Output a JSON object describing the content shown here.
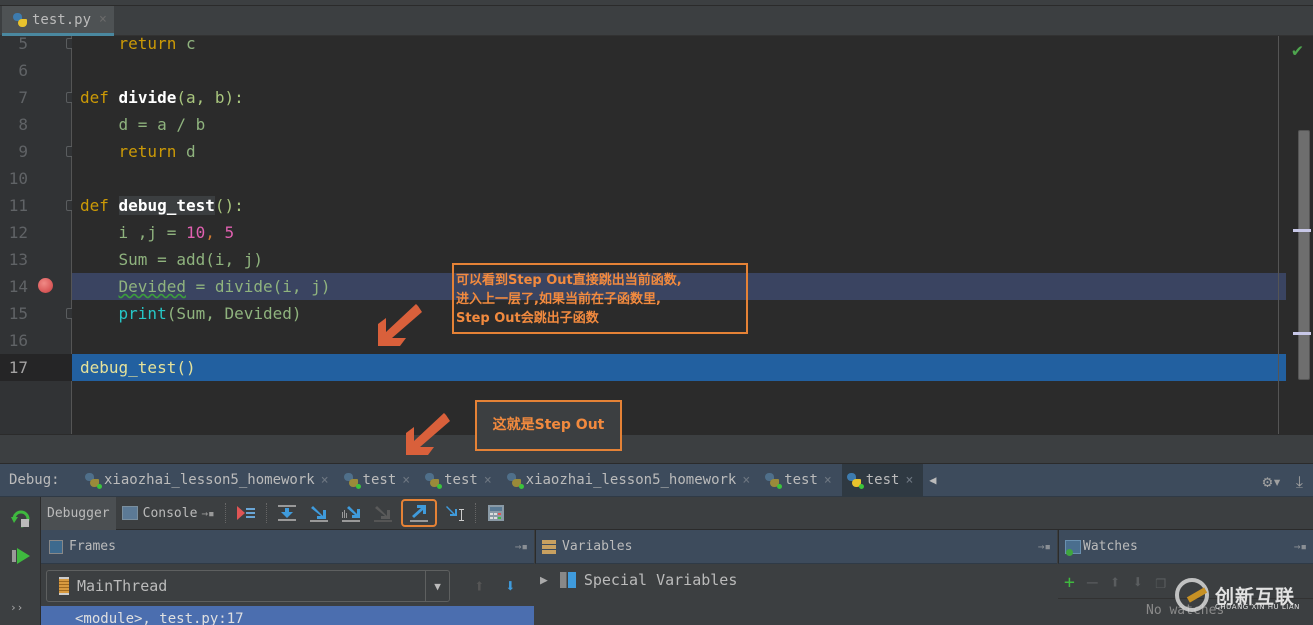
{
  "editor": {
    "file_tab": {
      "label": "test.py",
      "close": "×"
    },
    "lines": [
      {
        "num": "5"
      },
      {
        "num": "6"
      },
      {
        "num": "7"
      },
      {
        "num": "8"
      },
      {
        "num": "9"
      },
      {
        "num": "10"
      },
      {
        "num": "11"
      },
      {
        "num": "12"
      },
      {
        "num": "13"
      },
      {
        "num": "14"
      },
      {
        "num": "15"
      },
      {
        "num": "16"
      },
      {
        "num": "17"
      }
    ],
    "code": {
      "l5_kw": "return",
      "l5_v": " c",
      "l7_kw": "def",
      "l7_fn": "divide",
      "l7_args": "(a, b):",
      "l8_text": "d = a / b",
      "l9_kw": "return",
      "l9_v": " d",
      "l11_kw": "def",
      "l11_fn": "debug_test",
      "l11_args": "():",
      "l12_a": "i ,j = ",
      "l12_n1": "10",
      "l12_c": ", ",
      "l12_n2": "5",
      "l13_text": "Sum = add(i, j)",
      "l14_var": "Devided",
      "l14_rest": " = divide(i, j)",
      "l15_bi": "print",
      "l15_rest": "(Sum, Devided)",
      "l17_text": "debug_test()"
    },
    "breakpoint_line": "14",
    "execution_line": "17"
  },
  "annotations": {
    "note1_line1": "可以看到Step Out直接跳出当前函数,",
    "note1_line2": "进入上一层了,如果当前在子函数里,",
    "note1_line3": "Step Out会跳出子函数",
    "note2": "这就是Step Out",
    "accent_color": "#e58236"
  },
  "debug": {
    "label": "Debug:",
    "run_tabs": [
      {
        "label": "xiaozhai_lesson5_homework",
        "close": "×"
      },
      {
        "label": "test",
        "close": "×"
      },
      {
        "label": "test",
        "close": "×"
      },
      {
        "label": "xiaozhai_lesson5_homework",
        "close": "×"
      },
      {
        "label": "test",
        "close": "×"
      },
      {
        "label": "test",
        "close": "×",
        "active": true
      }
    ],
    "sub_tabs": {
      "debugger": "Debugger",
      "console": "Console"
    },
    "toolbar": {
      "show_execution_point": "Show Execution Point",
      "step_over": "Step Over",
      "step_into": "Step Into",
      "step_into_my_code": "Step Into My Code",
      "force_step_into": "Force Step Into",
      "step_out": "Step Out",
      "run_to_cursor": "Run to Cursor",
      "evaluate_expression": "Evaluate Expression"
    },
    "frames": {
      "title": "Frames",
      "thread": "MainThread",
      "rows": [
        {
          "label": "<module>, test.py:17"
        }
      ]
    },
    "variables": {
      "title": "Variables",
      "rows": [
        {
          "label": "Special Variables"
        }
      ]
    },
    "watches": {
      "title": "Watches",
      "empty": "No watches"
    }
  },
  "watermark": {
    "text": "创新互联",
    "sub": "CHUANG XIN HU LIAN"
  }
}
